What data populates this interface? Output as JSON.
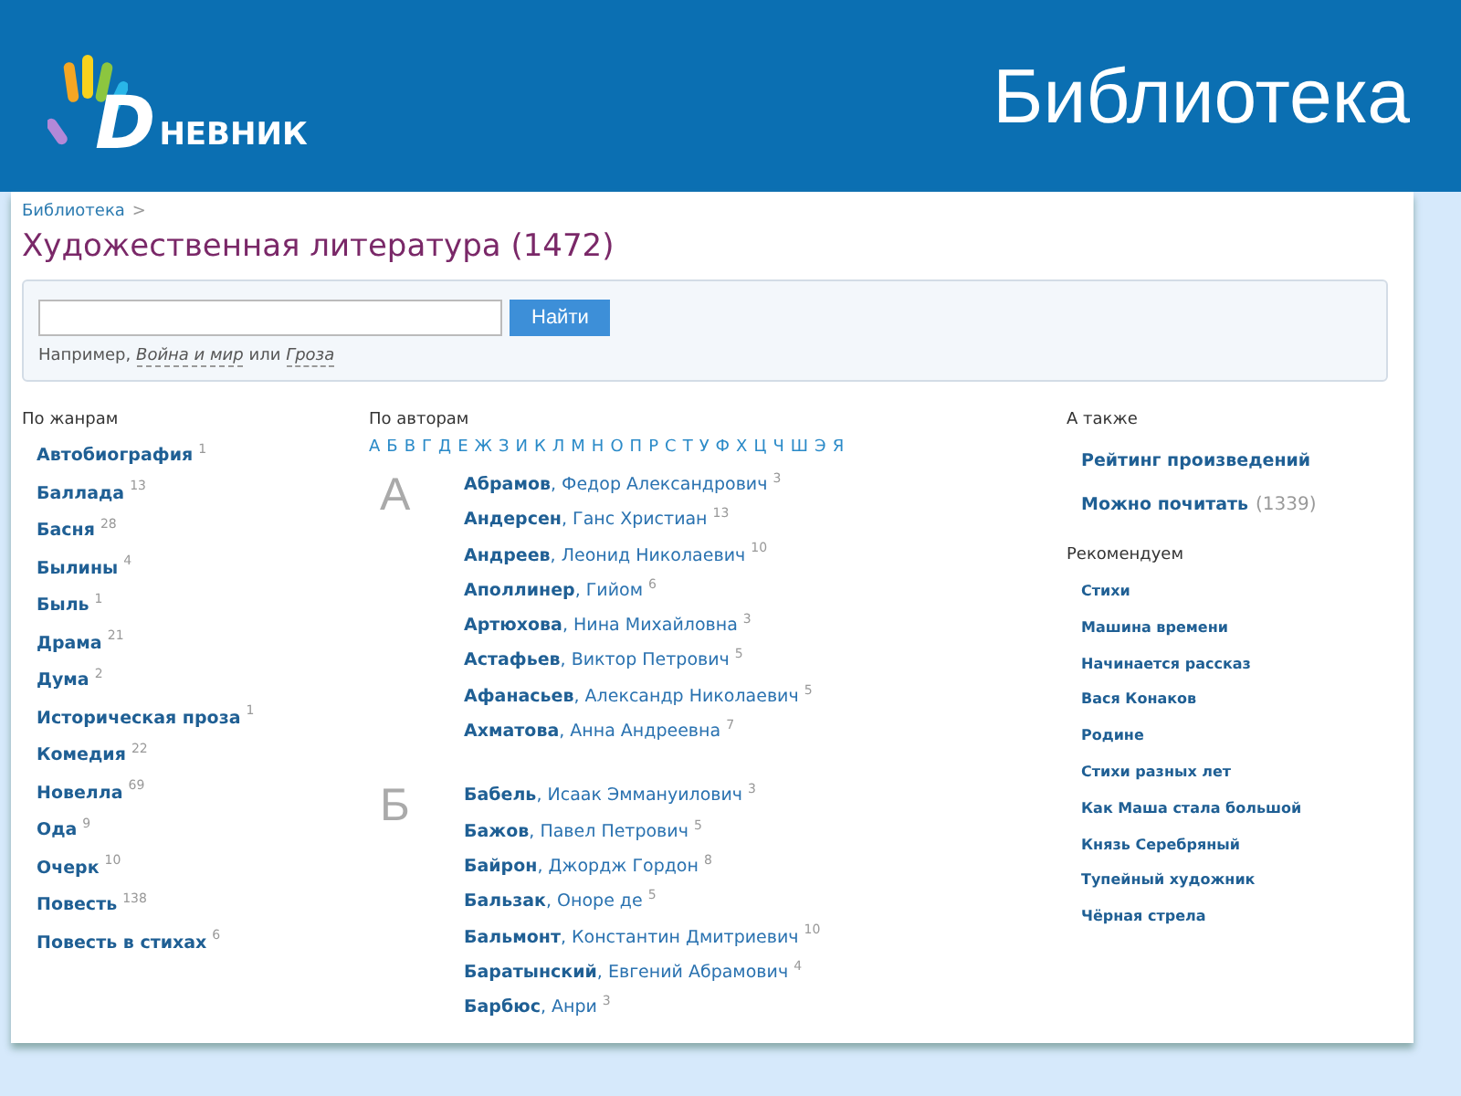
{
  "header": {
    "logo": {
      "letter": "D",
      "text": "НЕВНИК"
    },
    "title": "Библиотека"
  },
  "breadcrumb": {
    "link": "Библиотека",
    "separator": ">"
  },
  "page_title": "Художественная литература (1472)",
  "search": {
    "button": "Найти",
    "hint": {
      "prefix": "Например,",
      "example_1": "Война и мир",
      "middle": "или",
      "example_2": "Гроза"
    }
  },
  "genres": {
    "heading": "По жанрам",
    "items": [
      {
        "name": "Автобиография",
        "count": "1"
      },
      {
        "name": "Баллада",
        "count": "13"
      },
      {
        "name": "Басня",
        "count": "28"
      },
      {
        "name": "Былины",
        "count": "4"
      },
      {
        "name": "Быль",
        "count": "1"
      },
      {
        "name": "Драма",
        "count": "21"
      },
      {
        "name": "Дума",
        "count": "2"
      },
      {
        "name": "Историческая проза",
        "count": "1"
      },
      {
        "name": "Комедия",
        "count": "22"
      },
      {
        "name": "Новелла",
        "count": "69"
      },
      {
        "name": "Ода",
        "count": "9"
      },
      {
        "name": "Очерк",
        "count": "10"
      },
      {
        "name": "Повесть",
        "count": "138"
      },
      {
        "name": "Повесть в стихах",
        "count": "6"
      }
    ]
  },
  "authors": {
    "heading": "По авторам",
    "alphabet": [
      "А",
      "Б",
      "В",
      "Г",
      "Д",
      "Е",
      "Ж",
      "З",
      "И",
      "К",
      "Л",
      "М",
      "Н",
      "О",
      "П",
      "Р",
      "С",
      "Т",
      "У",
      "Ф",
      "Х",
      "Ц",
      "Ч",
      "Ш",
      "Э",
      "Я"
    ],
    "groups": [
      {
        "letter": "А",
        "items": [
          {
            "author": "**Абрамов**, Федор Александрович",
            "count": "3"
          },
          {
            "author": "**Андерсен**, Ганс Христиан",
            "count": "13"
          },
          {
            "author": "**Андреев**, Леонид Николаевич",
            "count": "10"
          },
          {
            "author": "**Аполлинер**, Гийом",
            "count": "6"
          },
          {
            "author": "**Артюхова**, Нина Михайловна",
            "count": "3"
          },
          {
            "author": "**Астафьев**, Виктор Петрович",
            "count": "5"
          },
          {
            "author": "**Афанасьев**, Александр Николаевич",
            "count": "5"
          },
          {
            "author": "**Ахматова**, Анна Андреевна",
            "count": "7"
          }
        ]
      },
      {
        "letter": "Б",
        "items": [
          {
            "author": "**Бабель**, Исаак Эммануилович",
            "count": "3"
          },
          {
            "author": "**Бажов**, Павел Петрович",
            "count": "5"
          },
          {
            "author": "**Байрон**, Джордж Гордон",
            "count": "8"
          },
          {
            "author": "**Бальзак**, Оноре де",
            "count": "5"
          },
          {
            "author": "**Бальмонт**, Константин Дмитриевич",
            "count": "10"
          },
          {
            "author": "**Баратынский**, Евгений Абрамович",
            "count": "4"
          },
          {
            "author": "**Барбюс**, Анри",
            "count": "3"
          }
        ]
      }
    ]
  },
  "also": {
    "heading": "А также",
    "items": [
      {
        "label": "Рейтинг произведений"
      },
      {
        "label": "Можно почитать",
        "count": "(1339)"
      }
    ]
  },
  "recommended": {
    "heading": "Рекомендуем",
    "items": [
      "Стихи",
      "Машина времени",
      "Начинается рассказ",
      "Вася Конаков",
      "Родине",
      "Стихи разных лет",
      "Как Маша стала большой",
      "Князь Серебряный",
      "Тупейный художник",
      "Чёрная стрела"
    ]
  }
}
